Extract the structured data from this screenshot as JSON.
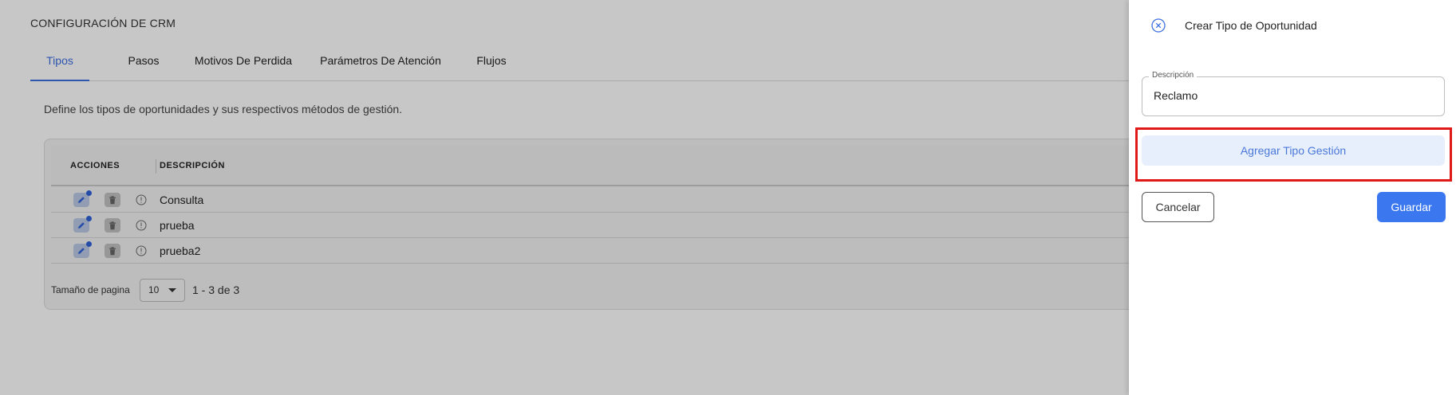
{
  "page": {
    "title": "CONFIGURACIÓN DE CRM",
    "description": "Define los tipos de oportunidades y sus respectivos métodos de gestión."
  },
  "tabs": [
    {
      "label": "Tipos",
      "active": true
    },
    {
      "label": "Pasos",
      "active": false
    },
    {
      "label": "Motivos De Perdida",
      "active": false
    },
    {
      "label": "Parámetros De Atención",
      "active": false
    },
    {
      "label": "Flujos",
      "active": false
    }
  ],
  "table": {
    "headers": {
      "actions": "ACCIONES",
      "description": "DESCRIPCIÓN"
    },
    "rows": [
      {
        "description": "Consulta"
      },
      {
        "description": "prueba"
      },
      {
        "description": "prueba2"
      }
    ],
    "row_actions": [
      "edit-icon",
      "trash-icon",
      "info-icon"
    ]
  },
  "pagination": {
    "page_size_label": "Tamaño de pagina",
    "page_size": "10",
    "range": "1 - 3 de 3"
  },
  "drawer": {
    "title": "Crear Tipo de Oportunidad",
    "description_label": "Descripción",
    "description_value": "Reclamo",
    "add_button": "Agregar Tipo Gestión",
    "cancel_button": "Cancelar",
    "save_button": "Guardar"
  },
  "colors": {
    "accent": "#3d6fe0",
    "primary_button": "#3b78f0",
    "add_button_bg": "#e8effc",
    "highlight": "#e01818"
  }
}
